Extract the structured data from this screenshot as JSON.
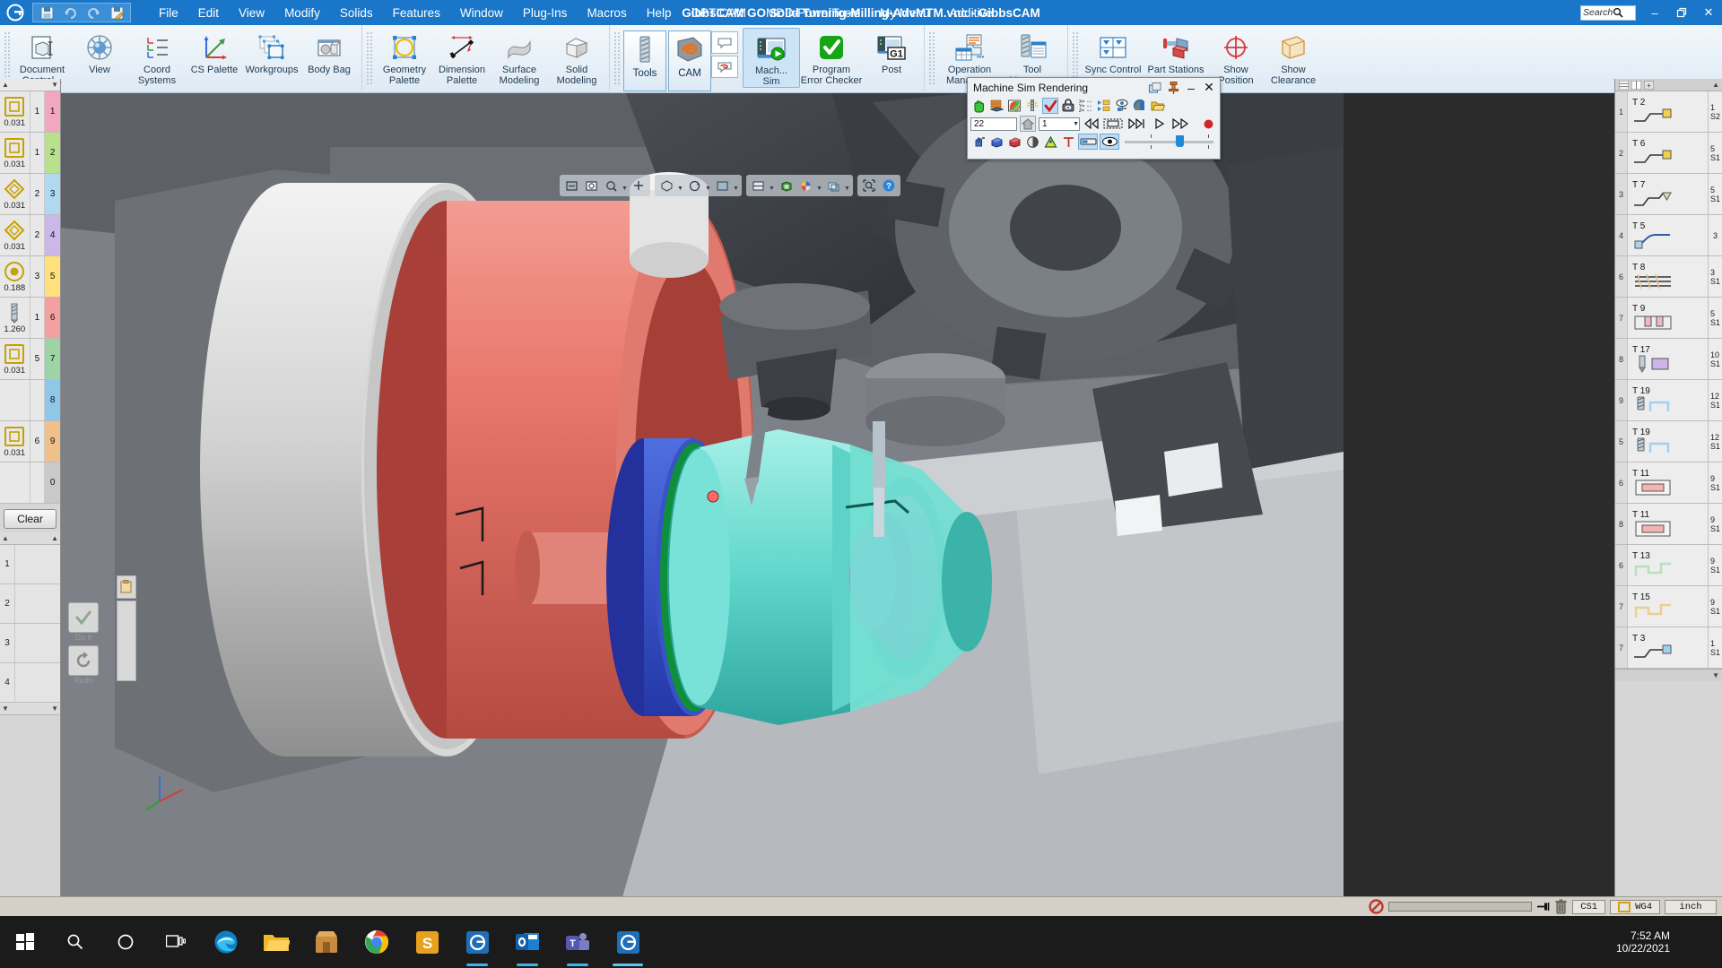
{
  "window": {
    "title": "GibbsCAM GO Solid Turning-Milling-AdvMTM.vnc - GibbsCAM",
    "logo": "gibbscam-logo",
    "search_placeholder": "Search",
    "minimize": "–",
    "restore": "❐",
    "close": "✕"
  },
  "quick_access": [
    {
      "name": "save",
      "icon": "save-icon"
    },
    {
      "name": "undo",
      "icon": "undo-icon"
    },
    {
      "name": "redo",
      "icon": "redo-icon"
    },
    {
      "name": "edit-document",
      "icon": "edit-document-icon"
    }
  ],
  "menubar": [
    "File",
    "Edit",
    "View",
    "Modify",
    "Solids",
    "Features",
    "Window",
    "Plug-Ins",
    "Macros",
    "Help",
    "OPTICAM",
    "MDD-PowerTools",
    "My Menu",
    "Additive"
  ],
  "ribbon": {
    "groups": [
      {
        "name": "document",
        "items": [
          {
            "label": "Document\nControl...",
            "icon": "document-control-icon"
          },
          {
            "label": "View",
            "icon": "view-sphere-icon"
          },
          {
            "label": "Coord\nSystems",
            "icon": "coord-systems-icon"
          },
          {
            "label": "CS Palette",
            "icon": "cs-palette-icon"
          },
          {
            "label": "Workgroups",
            "icon": "workgroups-icon"
          },
          {
            "label": "Body Bag",
            "icon": "body-bag-icon"
          }
        ]
      },
      {
        "name": "modeling",
        "items": [
          {
            "label": "Geometry\nPalette",
            "icon": "geometry-palette-icon"
          },
          {
            "label": "Dimension\nPalette",
            "icon": "dimension-palette-icon"
          },
          {
            "label": "Surface\nModeling",
            "icon": "surface-modeling-icon"
          },
          {
            "label": "Solid\nModeling",
            "icon": "solid-modeling-icon"
          }
        ]
      },
      {
        "name": "machining",
        "items": [
          {
            "label": "Tools",
            "icon": "tools-icon",
            "selected": true
          },
          {
            "label": "CAM",
            "icon": "cam-icon",
            "selected": true
          },
          {
            "label": "Mach...\nSim",
            "icon": "machine-sim-icon",
            "selected": true
          },
          {
            "label": "Program\nError Checker",
            "icon": "program-error-checker-icon"
          },
          {
            "label": "Post",
            "icon": "post-icon"
          }
        ]
      },
      {
        "name": "managers",
        "items": [
          {
            "label": "Operation\nManager...",
            "icon": "operation-manager-icon"
          },
          {
            "label": "Tool\nManager...",
            "icon": "tool-manager-icon"
          }
        ]
      },
      {
        "name": "mtm",
        "items": [
          {
            "label": "Sync Control",
            "icon": "sync-control-icon"
          },
          {
            "label": "Part Stations",
            "icon": "part-stations-icon"
          },
          {
            "label": "Show\nPosition",
            "icon": "show-position-icon"
          },
          {
            "label": "Show\nClearance",
            "icon": "show-clearance-icon"
          }
        ]
      }
    ]
  },
  "viewport_toolbar": {
    "groups": [
      {
        "buttons": [
          {
            "icon": "zoom-window-icon"
          },
          {
            "icon": "zoom-fit-icon"
          },
          {
            "icon": "zoom-in-icon"
          },
          {
            "icon": "pan-icon"
          }
        ]
      },
      {
        "buttons": [
          {
            "icon": "rotate-icon"
          },
          {
            "icon": "view-cube-icon",
            "caret": true
          },
          {
            "icon": "orientation-icon",
            "caret": true
          }
        ]
      },
      {
        "buttons": [
          {
            "icon": "display-mode-icon"
          },
          {
            "icon": "shade-icon",
            "caret": true
          },
          {
            "icon": "color-wheel-icon",
            "caret": true
          },
          {
            "icon": "layers-icon",
            "caret": true
          }
        ]
      },
      {
        "buttons": [
          {
            "icon": "magnify-select-icon"
          },
          {
            "icon": "help-icon"
          }
        ]
      }
    ]
  },
  "tool_palette": {
    "title": "tool-list",
    "rows": [
      {
        "num": "1",
        "idx": "1",
        "dia": "0.031",
        "shape": "square-insert",
        "color": "#f2a6c0"
      },
      {
        "num": "1",
        "idx": "2",
        "dia": "0.031",
        "shape": "square-insert",
        "color": "#b9e08a"
      },
      {
        "num": "2",
        "idx": "3",
        "dia": "0.031",
        "shape": "diamond-insert",
        "color": "#b0d8f0"
      },
      {
        "num": "2",
        "idx": "4",
        "dia": "0.031",
        "shape": "diamond-insert",
        "color": "#cbb8e8"
      },
      {
        "num": "3",
        "idx": "5",
        "dia": "0.188",
        "shape": "round-insert",
        "color": "#ffe07a"
      },
      {
        "num": "1",
        "idx": "6",
        "dia": "1.260",
        "shape": "drill",
        "color": "#f4a0a0"
      },
      {
        "num": "5",
        "idx": "7",
        "dia": "0.031",
        "shape": "square-insert",
        "color": "#9ed3a6"
      },
      {
        "num": "",
        "idx": "8",
        "dia": "",
        "shape": "blank",
        "color": "#8ec7ea"
      },
      {
        "num": "6",
        "idx": "9",
        "dia": "0.031",
        "shape": "square-insert",
        "color": "#f0c089"
      },
      {
        "num": "",
        "idx": "0",
        "dia": "",
        "shape": "blank",
        "color": "#c9c9c9"
      }
    ],
    "clear_label": "Clear",
    "op_rows": [
      "1",
      "2",
      "3",
      "4"
    ],
    "buttons": [
      {
        "name": "do-it-button",
        "label": "Do It",
        "icon": "checkmark-icon"
      },
      {
        "name": "redo-button",
        "label": "Redo",
        "icon": "circular-arrow-icon"
      }
    ]
  },
  "operation_palette": {
    "rows": [
      {
        "tool": "T 2",
        "sub": "1",
        "op": "S2",
        "idx": "1",
        "color": "#f3d04a",
        "icon": "turn-rough-icon"
      },
      {
        "tool": "T 6",
        "sub": "5",
        "op": "S1",
        "idx": "2",
        "color": "#f3d04a",
        "icon": "turn-rough-icon"
      },
      {
        "tool": "T 7",
        "sub": "5",
        "op": "S1",
        "idx": "3",
        "color": "#c8e8a0",
        "icon": "turn-finish-icon"
      },
      {
        "tool": "T 5",
        "sub": "3",
        "op": "",
        "idx": "4",
        "color": "#a9d3f2",
        "icon": "contour-icon"
      },
      {
        "tool": "T 8",
        "sub": "3",
        "op": "S1",
        "idx": "6",
        "color": "#e0c48c",
        "icon": "thread-icon"
      },
      {
        "tool": "T 9",
        "sub": "5",
        "op": "S1",
        "idx": "7",
        "color": "#efb5cd",
        "icon": "groove-icon"
      },
      {
        "tool": "T 17",
        "sub": "10",
        "op": "S1",
        "idx": "8",
        "color": "#cdb5e8",
        "icon": "drill-op-icon"
      },
      {
        "tool": "T 19",
        "sub": "12",
        "op": "S1",
        "idx": "9",
        "color": "#9fd2ee",
        "icon": "mill-op-icon"
      },
      {
        "tool": "T 19",
        "sub": "12",
        "op": "S1",
        "idx": "5",
        "color": "#9fd2ee",
        "icon": "mill-op-icon"
      },
      {
        "tool": "T 11",
        "sub": "9",
        "op": "S1",
        "idx": "6",
        "color": "#f3b3b3",
        "icon": "pocket-icon"
      },
      {
        "tool": "T 11",
        "sub": "9",
        "op": "S1",
        "idx": "8",
        "color": "#f3b3b3",
        "icon": "pocket-icon"
      },
      {
        "tool": "T 13",
        "sub": "9",
        "op": "S1",
        "idx": "6",
        "color": "#b8e0bb",
        "icon": "profile-icon"
      },
      {
        "tool": "T 15",
        "sub": "9",
        "op": "S1",
        "idx": "7",
        "color": "#ead08c",
        "icon": "profile-icon"
      },
      {
        "tool": "T 3",
        "sub": "1",
        "op": "S1",
        "idx": "7",
        "color": "#9fd2ee",
        "icon": "turn-rough-icon"
      }
    ]
  },
  "machine_sim_dialog": {
    "title": "Machine Sim Rendering",
    "titlebar_buttons": [
      {
        "name": "restore-dock-button",
        "icon": "restore-window-icon"
      },
      {
        "name": "pin-button",
        "icon": "pushpin-icon"
      },
      {
        "name": "minimize-button",
        "icon": "minimize-icon"
      },
      {
        "name": "close-button",
        "icon": "close-icon"
      }
    ],
    "toolbar_row1": [
      {
        "name": "grab-pan-tool",
        "icon": "green-hand-icon"
      },
      {
        "name": "layers-tool",
        "icon": "orange-layers-icon"
      },
      {
        "name": "color-edit-tool",
        "icon": "color-pencil-icon"
      },
      {
        "name": "tool-flash",
        "icon": "tool-burst-icon"
      },
      {
        "name": "verify-check",
        "icon": "red-check-icon",
        "active": true
      },
      {
        "name": "lock-view",
        "icon": "lock-eye-icon"
      },
      {
        "name": "xyz-readout",
        "icon": "xyz-icon"
      },
      {
        "name": "step-list",
        "icon": "step-list-icon"
      },
      {
        "name": "visibility-tool",
        "icon": "eye-machine-icon"
      },
      {
        "name": "shade-tool",
        "icon": "shade-blue-icon"
      },
      {
        "name": "open-file",
        "icon": "folder-open-icon"
      }
    ],
    "step_value": "22",
    "home_button": "home-icon",
    "speed_value": "1",
    "playback": [
      {
        "name": "rewind-to-start",
        "icon": "rewind-start-icon"
      },
      {
        "name": "single-frame",
        "icon": "frame-icon"
      },
      {
        "name": "step-forward",
        "icon": "step-forward-icon"
      },
      {
        "name": "play",
        "icon": "play-icon"
      },
      {
        "name": "fast-forward",
        "icon": "fast-forward-icon"
      },
      {
        "name": "record",
        "icon": "record-red-dot-icon"
      }
    ],
    "toolbar_row3": [
      {
        "name": "pick-tool",
        "icon": "pick-hand-icon"
      },
      {
        "name": "stock-blue",
        "icon": "blue-block-icon"
      },
      {
        "name": "stock-red",
        "icon": "red-block-icon"
      },
      {
        "name": "transparency",
        "icon": "half-circle-icon"
      },
      {
        "name": "collision-warning",
        "icon": "warning-triangle-icon"
      },
      {
        "name": "measure",
        "icon": "caliper-t-icon"
      },
      {
        "name": "toolpath-toggle",
        "icon": "toolpath-bar-icon",
        "active": true
      },
      {
        "name": "eye-toggle",
        "icon": "eye-icon",
        "active": true
      }
    ],
    "slider_position_pct": 55
  },
  "statusbar": {
    "stop_icon": "stop-sign-icon",
    "progress_pct": 0,
    "pin_icon": "pin-icon",
    "trash_icon": "trash-icon",
    "cs_label": "CS1",
    "wg_label": "WG4",
    "wg_icon": "workgroup-square-icon",
    "units": "inch"
  },
  "taskbar": {
    "items": [
      {
        "name": "start-button",
        "icon": "windows-icon"
      },
      {
        "name": "search-button",
        "icon": "search-icon"
      },
      {
        "name": "cortana-button",
        "icon": "circle-icon"
      },
      {
        "name": "task-view-button",
        "icon": "task-view-icon"
      },
      {
        "name": "edge-app",
        "icon": "edge-icon",
        "accent": "#39b5ea"
      },
      {
        "name": "file-explorer-app",
        "icon": "folder-icon",
        "accent": "#ffc83d"
      },
      {
        "name": "store-app",
        "icon": "store-icon",
        "accent": "#b06a2b"
      },
      {
        "name": "chrome-app",
        "icon": "chrome-icon",
        "accent": "#4285f4"
      },
      {
        "name": "sage-app",
        "icon": "s-app-icon",
        "accent": "#f0a500"
      },
      {
        "name": "gibbscam-app",
        "icon": "gibbscam-taskbar-icon",
        "accent": "#1976c8",
        "running": true
      },
      {
        "name": "outlook-app",
        "icon": "outlook-icon",
        "accent": "#0f6cbd",
        "running": true
      },
      {
        "name": "teams-app",
        "icon": "teams-icon",
        "accent": "#5b5fc7",
        "running": true
      },
      {
        "name": "gibbscam-window",
        "icon": "gibbscam-window-icon",
        "accent": "#1976c8",
        "running": true
      }
    ],
    "time": "7:52 AM",
    "date": "10/22/2021"
  }
}
